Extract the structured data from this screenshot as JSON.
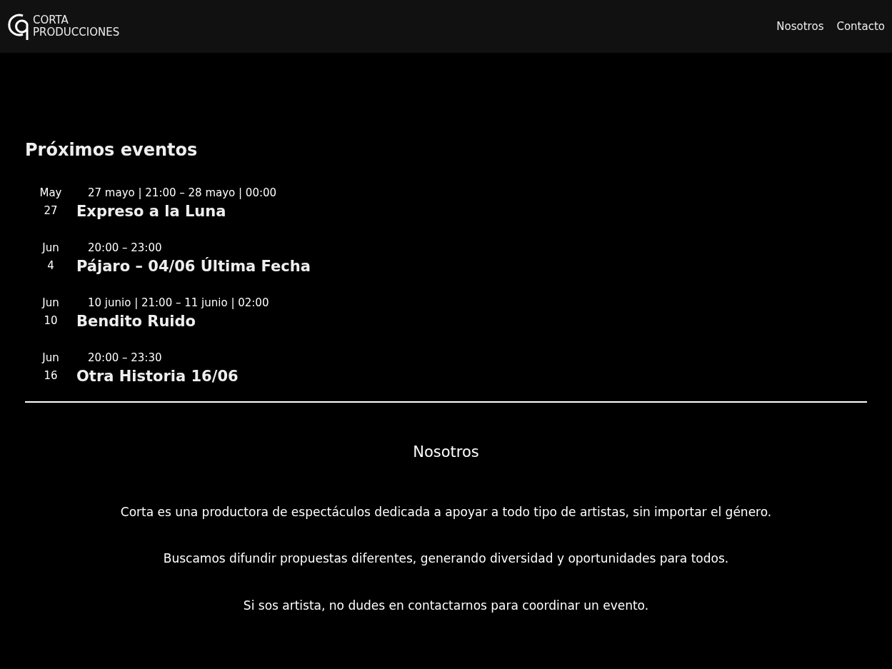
{
  "header": {
    "logo_lines": [
      "CORTA",
      "PRODUCCIONES"
    ],
    "nav": [
      "Nosotros",
      "Contacto"
    ]
  },
  "events": {
    "title": "Próximos eventos",
    "items": [
      {
        "month": "May",
        "day": "27",
        "time": "27 mayo | 21:00 – 28 mayo | 00:00",
        "name": "Expreso a la Luna"
      },
      {
        "month": "Jun",
        "day": "4",
        "time": "20:00 – 23:00",
        "name": "Pájaro – 04/06 Última Fecha"
      },
      {
        "month": "Jun",
        "day": "10",
        "time": "10 junio | 21:00 – 11 junio | 02:00",
        "name": "Bendito Ruido"
      },
      {
        "month": "Jun",
        "day": "16",
        "time": "20:00 – 23:30",
        "name": "Otra Historia 16/06"
      }
    ]
  },
  "about": {
    "title": "Nosotros",
    "paragraphs": [
      "Corta es una productora de espectáculos dedicada a apoyar a todo tipo de artistas, sin importar el género.",
      "Buscamos difundir propuestas diferentes, generando diversidad y oportunidades para todos.",
      "Si sos artista, no dudes en contactarnos para coordinar un evento."
    ]
  }
}
